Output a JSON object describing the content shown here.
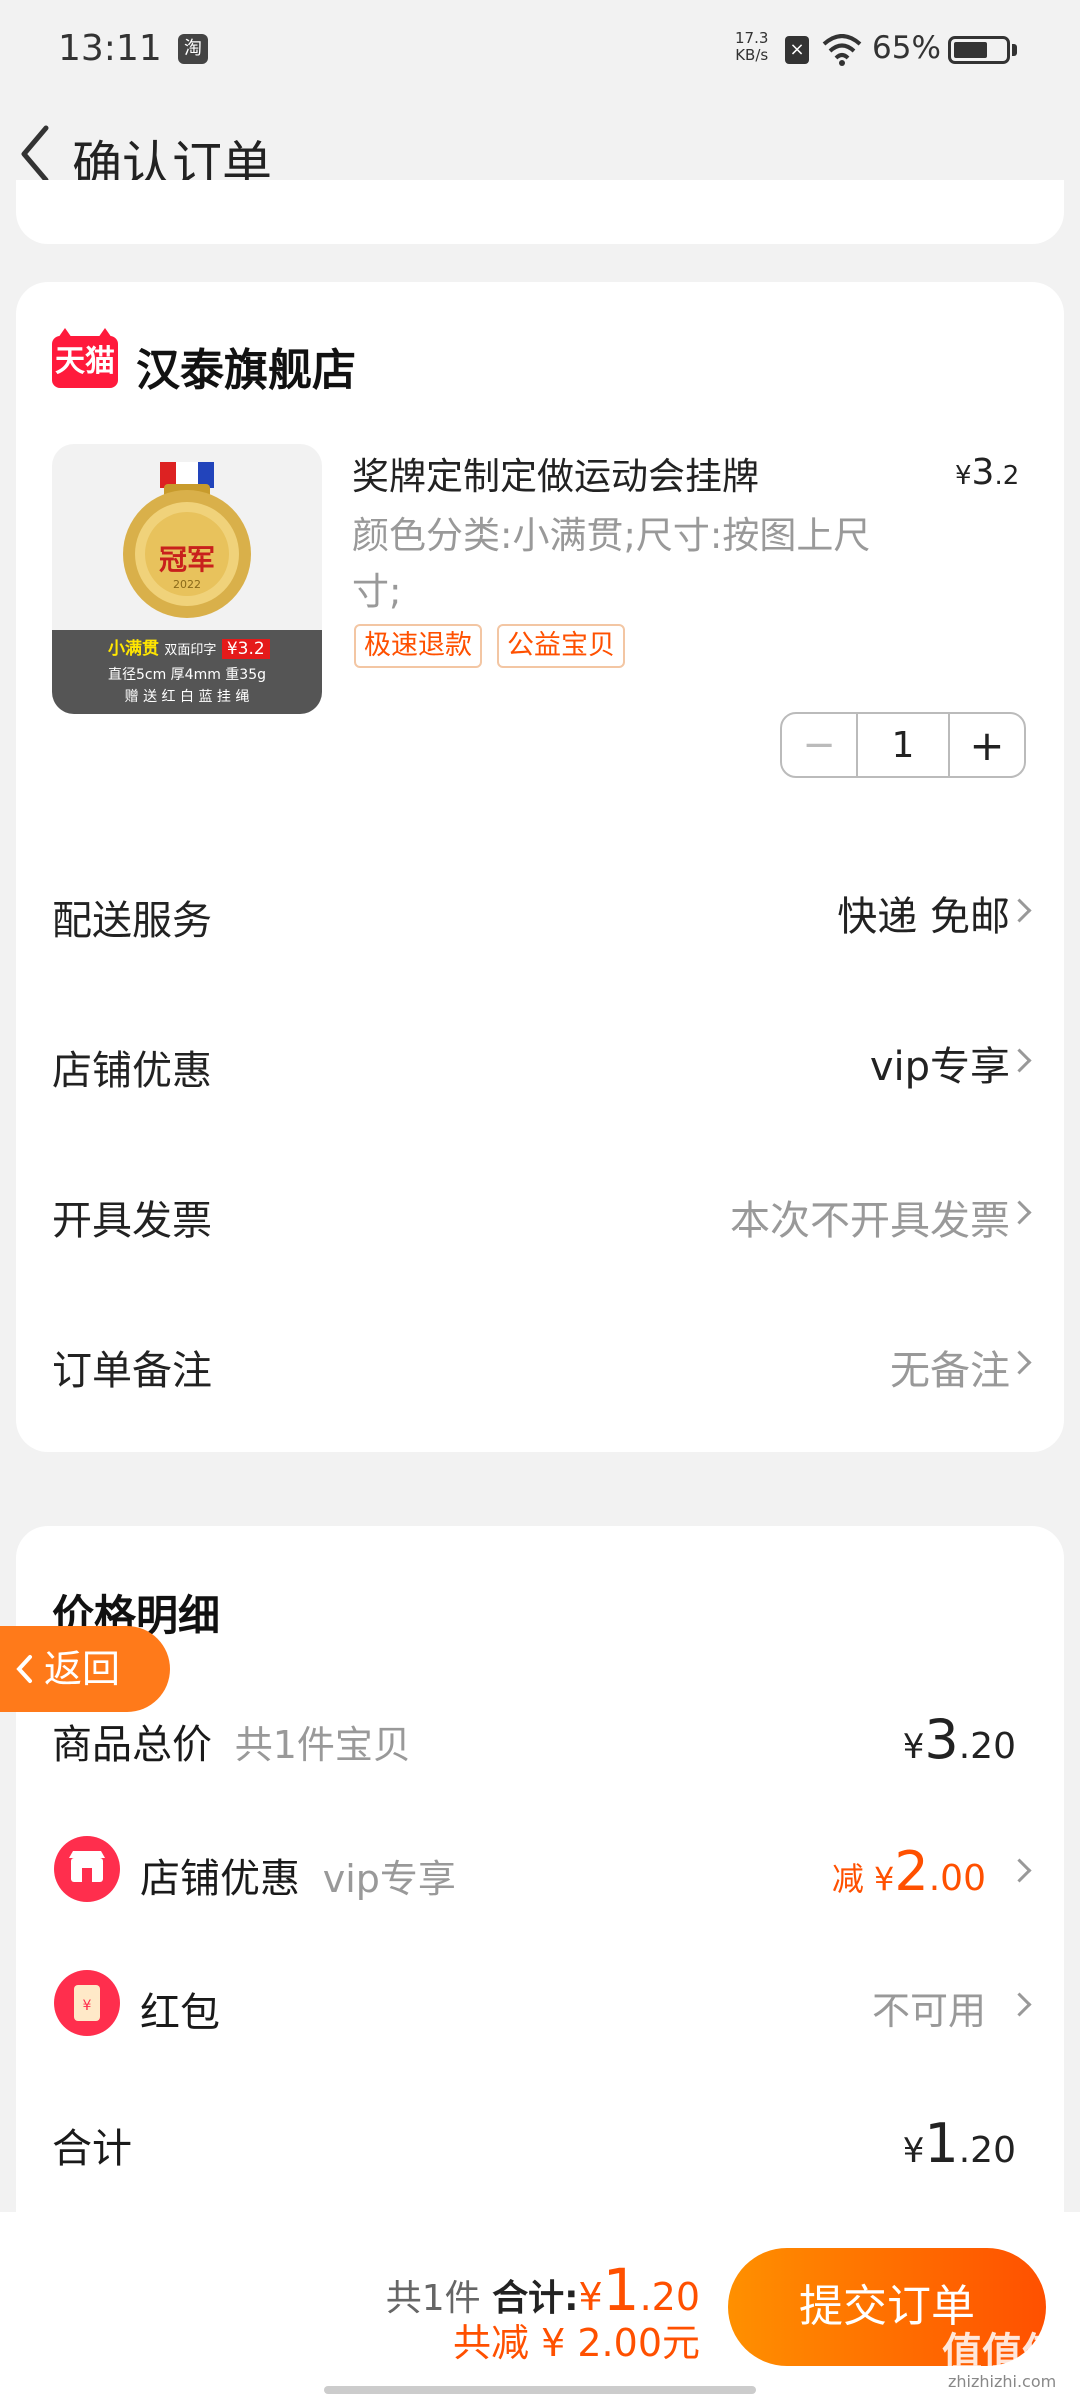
{
  "status_bar": {
    "time": "13:11",
    "app_icon_label": "淘",
    "net_speed_value": "17.3",
    "net_speed_unit": "KB/s",
    "battery_percent": "65%",
    "battery_level": 0.65
  },
  "header": {
    "title": "确认订单"
  },
  "store": {
    "badge": "天猫",
    "name": "汉泰旗舰店"
  },
  "product": {
    "title": "奖牌定制定做运动会挂牌",
    "price_symbol": "¥",
    "price_int": "3",
    "price_dec": ".2",
    "spec": "颜色分类:小满贯;尺寸:按图上尺寸;",
    "tags": [
      "极速退款",
      "公益宝贝"
    ],
    "quantity": "1",
    "image": {
      "medal_text": "冠军",
      "medal_year": "2022",
      "promo_name": "小满贯",
      "promo_desc": "双面印字",
      "promo_price": "¥3.2",
      "dims": "直径5cm  厚4mm  重35g",
      "gift": "赠 送 红 白 蓝 挂 绳"
    }
  },
  "rows": [
    {
      "label": "配送服务",
      "value": "快递 免邮",
      "emphasis": true
    },
    {
      "label": "店铺优惠",
      "value": "vip专享",
      "emphasis": true
    },
    {
      "label": "开具发票",
      "value": "本次不开具发票",
      "emphasis": false
    },
    {
      "label": "订单备注",
      "value": "无备注",
      "emphasis": false
    }
  ],
  "price_detail": {
    "title": "价格明细",
    "goods_total": {
      "label": "商品总价",
      "sub": "共1件宝贝",
      "symbol": "¥",
      "int": "3",
      "dec": ".20"
    },
    "store_discount": {
      "label": "店铺优惠",
      "sub": "vip专享",
      "prefix": "减 ¥",
      "int": "2",
      "dec": ".00"
    },
    "red_packet": {
      "label": "红包",
      "value": "不可用"
    },
    "total": {
      "label": "合计",
      "symbol": "¥",
      "int": "1",
      "dec": ".20"
    }
  },
  "float_back": {
    "label": "返回"
  },
  "bottom_bar": {
    "count_text": "共1件",
    "sum_label": "合计:",
    "sum_symbol": "¥",
    "sum_int": "1",
    "sum_dec": ".20",
    "saved_text": "共减 ¥ 2.00元",
    "submit_label": "提交订单"
  },
  "watermark": {
    "text": "值值值",
    "url": "zhizhizhi.com"
  },
  "colors": {
    "accent": "#ff5000",
    "tmall_red": "#ff1a3c",
    "background": "#f2f2f2"
  }
}
